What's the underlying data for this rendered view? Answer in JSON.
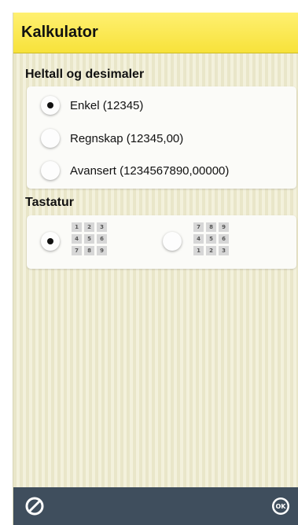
{
  "app": {
    "title": "Kalkulator"
  },
  "sections": {
    "decimals": {
      "heading": "Heltall og desimaler",
      "options": [
        {
          "label": "Enkel (12345)",
          "selected": true
        },
        {
          "label": "Regnskap (12345,00)",
          "selected": false
        },
        {
          "label": "Avansert (1234567890,00000)",
          "selected": false
        }
      ]
    },
    "keyboard": {
      "heading": "Tastatur",
      "layouts": [
        {
          "keys": [
            "1",
            "2",
            "3",
            "4",
            "5",
            "6",
            "7",
            "8",
            "9"
          ],
          "selected": true
        },
        {
          "keys": [
            "7",
            "8",
            "9",
            "4",
            "5",
            "6",
            "1",
            "2",
            "3"
          ],
          "selected": false
        }
      ]
    }
  },
  "footer": {
    "cancel_icon": "no-icon",
    "ok_icon": "ok-icon"
  },
  "colors": {
    "titlebar": "#f7e23a",
    "bottombar": "#3f4e5d",
    "background": "#ece9cf"
  }
}
